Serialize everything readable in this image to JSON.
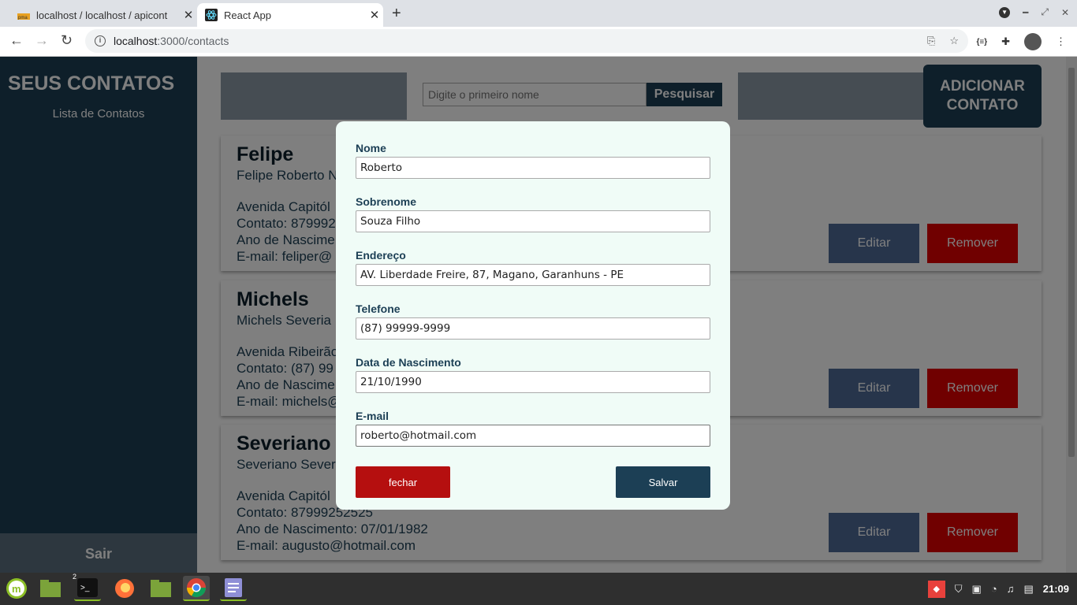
{
  "browser": {
    "tabs": [
      {
        "title": "localhost / localhost / apicont"
      },
      {
        "title": "React App"
      }
    ],
    "url_host": "localhost",
    "url_path": ":3000/contacts"
  },
  "sidebar": {
    "brand": "SEUS CONTATOS",
    "item": "Lista de Contatos",
    "logout": "Sair"
  },
  "search": {
    "placeholder": "Digite o primeiro nome",
    "button": "Pesquisar"
  },
  "add_button": "ADICIONAR CONTATO",
  "contacts": [
    {
      "name": "Felipe",
      "full": "Felipe Roberto N",
      "line1": "Avenida Capitól",
      "line2": "Contato: 879992",
      "line3": "Ano de Nascime",
      "line4": "E-mail: feliper@"
    },
    {
      "name": "Michels",
      "full": "Michels Severia",
      "line1": "Avenida Ribeirão",
      "line2": "Contato: (87) 99",
      "line3": "Ano de Nascime",
      "line4": "E-mail: michels@"
    },
    {
      "name": "Severiano",
      "full": "Severiano Sever",
      "line1": "Avenida Capitól",
      "line2": "Contato: 87999252525",
      "line3": "Ano de Nascimento: 07/01/1982",
      "line4": "E-mail: augusto@hotmail.com"
    }
  ],
  "card_buttons": {
    "edit": "Editar",
    "remove": "Remover"
  },
  "modal": {
    "fields": [
      {
        "label": "Nome",
        "value": "Roberto"
      },
      {
        "label": "Sobrenome",
        "value": "Souza Filho"
      },
      {
        "label": "Endereço",
        "value": "AV. Liberdade Freire, 87, Magano, Garanhuns - PE"
      },
      {
        "label": "Telefone",
        "value": "(87) 99999-9999"
      },
      {
        "label": "Data de Nascimento",
        "value": "21/10/1990"
      },
      {
        "label": "E-mail",
        "value": "roberto@hotmail.com"
      }
    ],
    "close": "fechar",
    "save": "Salvar"
  },
  "taskbar": {
    "terminal_badge": "2",
    "clock": "21:09"
  },
  "colors": {
    "sidebar": "#1c3f55",
    "edit": "#4f6a97",
    "remove": "#e00000",
    "modal_bg": "#f0fcf7"
  }
}
